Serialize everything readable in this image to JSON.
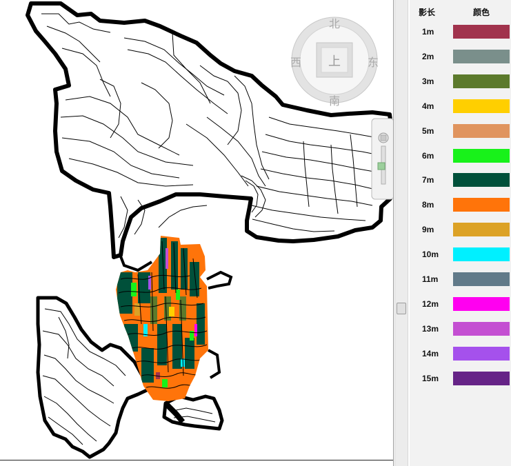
{
  "compass": {
    "north": "北",
    "south": "南",
    "east": "东",
    "west": "西",
    "center": "上"
  },
  "legend": {
    "header_length": "影长",
    "header_color": "颜色",
    "items": [
      {
        "label": "1m",
        "color": "#a1334d"
      },
      {
        "label": "2m",
        "color": "#7a8f8b"
      },
      {
        "label": "3m",
        "color": "#5c7a2c"
      },
      {
        "label": "4m",
        "color": "#ffcf00"
      },
      {
        "label": "5m",
        "color": "#e0945e"
      },
      {
        "label": "6m",
        "color": "#18f21a"
      },
      {
        "label": "7m",
        "color": "#00503a"
      },
      {
        "label": "8m",
        "color": "#ff740a"
      },
      {
        "label": "9m",
        "color": "#dca226"
      },
      {
        "label": "10m",
        "color": "#00f0ff"
      },
      {
        "label": "11m",
        "color": "#617a89"
      },
      {
        "label": "12m",
        "color": "#ff00f0"
      },
      {
        "label": "13m",
        "color": "#c44fd2"
      },
      {
        "label": "14m",
        "color": "#a551ec"
      },
      {
        "label": "15m",
        "color": "#662487"
      }
    ]
  }
}
